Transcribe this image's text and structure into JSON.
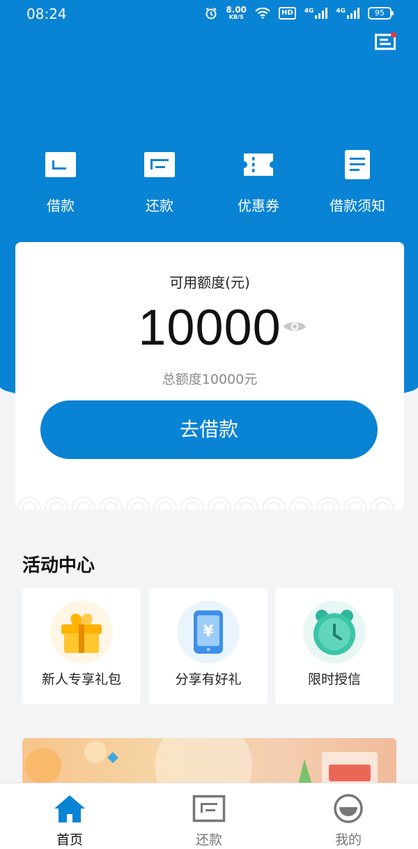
{
  "status_bar": {
    "time": "08:24",
    "net_speed_value": "8.00",
    "net_speed_unit": "KB/S",
    "hd_badge": "HD",
    "signal_1": "4G",
    "signal_2": "4G",
    "battery": "95"
  },
  "quick_nav": [
    {
      "label": "借款",
      "icon": "loan-icon"
    },
    {
      "label": "还款",
      "icon": "repay-icon"
    },
    {
      "label": "优惠券",
      "icon": "coupon-icon"
    },
    {
      "label": "借款须知",
      "icon": "notice-icon"
    }
  ],
  "credit": {
    "title": "可用额度(元)",
    "amount": "10000",
    "total": "总额度10000元",
    "borrow_button": "去借款"
  },
  "activity": {
    "title": "活动中心",
    "items": [
      {
        "label": "新人专享礼包",
        "icon": "gift-icon"
      },
      {
        "label": "分享有好礼",
        "icon": "phone-yuan-icon"
      },
      {
        "label": "限时授信",
        "icon": "alarm-clock-icon"
      }
    ]
  },
  "tabbar": {
    "items": [
      {
        "label": "首页",
        "icon": "home-icon",
        "active": true
      },
      {
        "label": "还款",
        "icon": "repay-icon",
        "active": false
      },
      {
        "label": "我的",
        "icon": "profile-icon",
        "active": false
      }
    ]
  },
  "colors": {
    "primary": "#0983d4",
    "background": "#f3f4f6",
    "inactive": "#777777"
  }
}
